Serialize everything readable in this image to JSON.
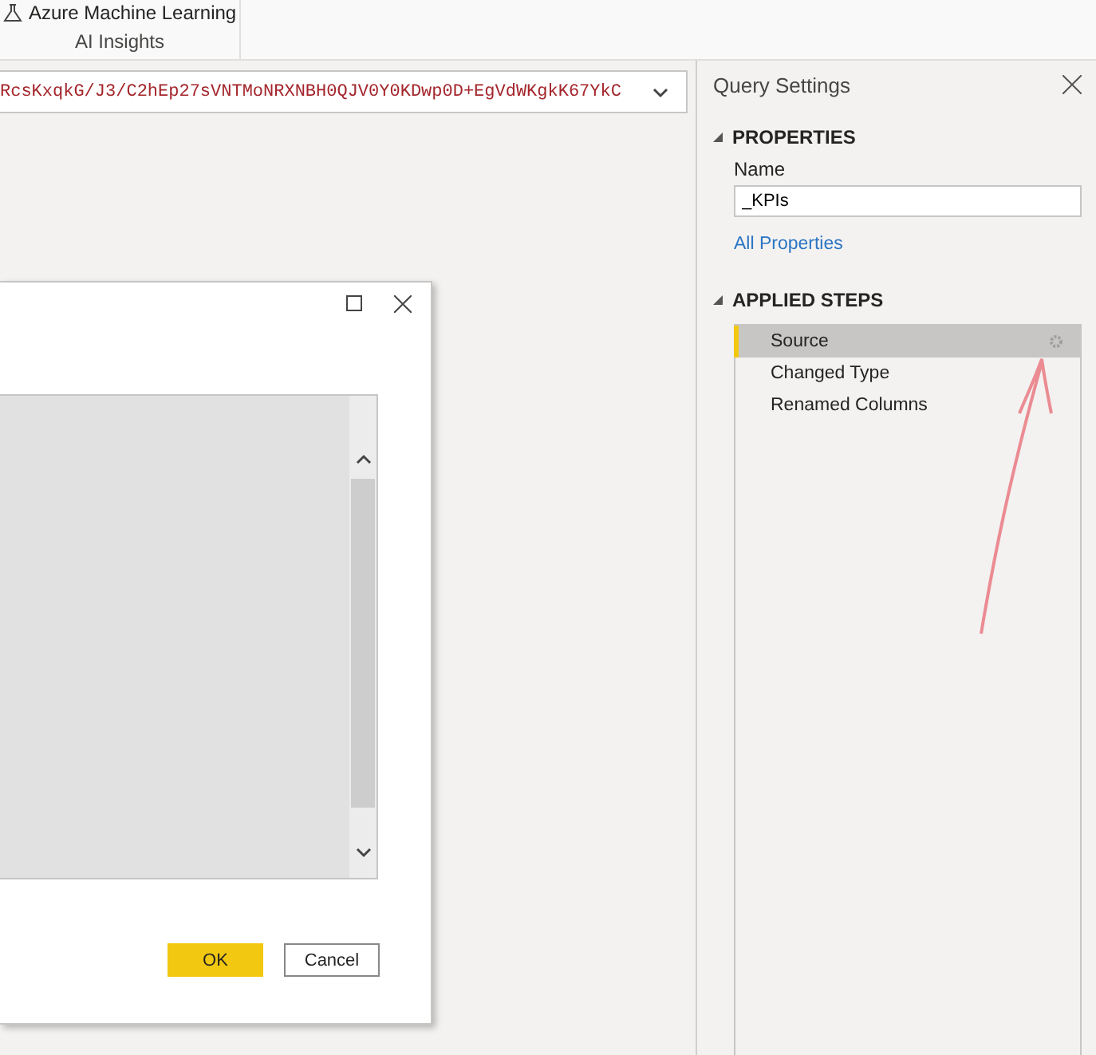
{
  "ribbon": {
    "button_label": "Azure Machine Learning",
    "group_label": "AI Insights"
  },
  "formula_bar": {
    "value": "RcsKxqkG/J3/C2hEp27sVNTMoNRXNBH0QJV0Y0KDwp0D+EgVdWKgkK67YkC"
  },
  "dialog": {
    "buttons": [
      {
        "label": "OK",
        "kind": "primary"
      },
      {
        "label": "Cancel",
        "kind": "secondary"
      }
    ]
  },
  "query_settings": {
    "title": "Query Settings",
    "properties": {
      "heading": "PROPERTIES",
      "name_label": "Name",
      "name_value": "_KPIs",
      "link": "All Properties"
    },
    "applied_steps": {
      "heading": "APPLIED STEPS",
      "steps": [
        {
          "label": "Source",
          "selected": true,
          "settings_icon": true
        },
        {
          "label": "Changed Type",
          "selected": false,
          "settings_icon": false
        },
        {
          "label": "Renamed Columns",
          "selected": false,
          "settings_icon": false
        }
      ]
    }
  }
}
